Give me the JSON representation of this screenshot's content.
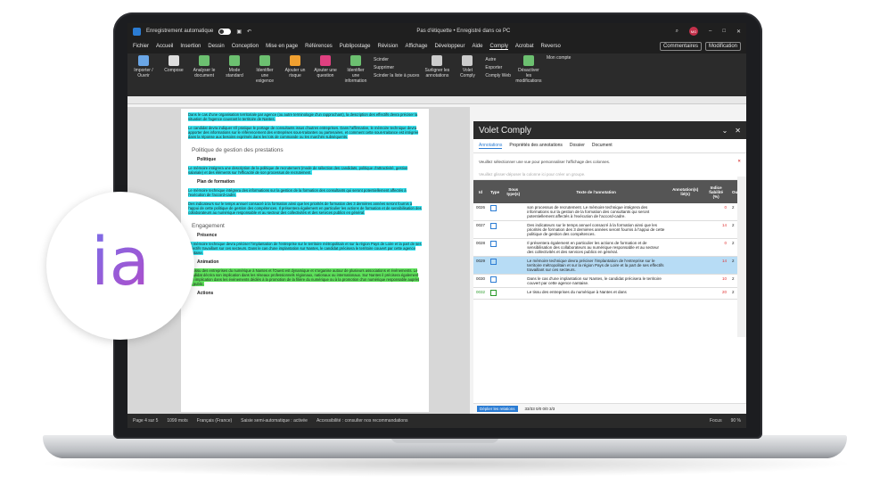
{
  "window": {
    "autosave_label": "Enregistrement automatique",
    "doc_title": "Pas d'étiquette • Enregistré dans ce PC",
    "avatar_initials": "MG"
  },
  "menu": {
    "items": [
      "Fichier",
      "Accueil",
      "Insertion",
      "Dessin",
      "Conception",
      "Mise en page",
      "Références",
      "Publipostage",
      "Révision",
      "Affichage",
      "Développeur",
      "Aide",
      "Comply",
      "Acrobat",
      "Reverso"
    ],
    "active": "Comply",
    "comments_label": "Commentaires",
    "modification_label": "Modification"
  },
  "ribbon": {
    "items": [
      "Importer / Ouvrir",
      "Compose",
      "Analyser le document",
      "Mode standard",
      "Identifier une exigence",
      "Ajouter un risque",
      "Ajouter une question",
      "Identifier une information"
    ],
    "list": [
      "Scinder",
      "Supprimer",
      "Scinder la liste à puces"
    ],
    "souligner": "Surligner les annotations",
    "volet": "Volet Comply",
    "autre": "Autre",
    "exporter": "Exporter",
    "comply_web": "Comply Web",
    "desactiver": "Désactiver les modifications",
    "mon_compte": "Mon compte",
    "group_compose": "Compose",
    "group_comply": "Comply"
  },
  "doc": {
    "p1": "Dans le cas d'une organisation territoriale par agence (ou autre terminologie d'un rapprochant), la description des effectifs devra préciser la situation de l'agence couvrant le territoire de Nantes.",
    "p2": "Le candidat devra indiquer s'il pratique le portage de consultants issus d'autres entreprises. Dans l'affirmative, le mémoire technique devra apporter des informations sur le référencement des entreprises sous-traitantes ou partenaires, et comment cette sous-traitance est intégrée dans la réponse aux besoins exprimés dans les lots de commande ou les marchés subséquents.",
    "h_gestion": "Politique de gestion des prestations",
    "h_politique": "Politique",
    "p3": "Le mémoire intégrera une description de la politique de recrutement (mode de sélection des candidats, politique d'attractivité, gestion salariale) et des éléments sur l'efficacité de son processus de recrutement.",
    "h_formation": "Plan de formation",
    "p4": "Le mémoire technique intégrera des informations sur la gestion de la formation des consultants qui seront potentiellement affectés à l'exécution de l'accord-cadre.",
    "p5": "Des indicateurs sur le temps annuel consacré à la formation ainsi que les priorités de formation des 3 dernières années seront fournis à l'appui de cette politique de gestion des compétences. Il présentera également en particulier les actions de formation et de sensibilisation des collaborateurs au numérique responsable et au secteur des collectivités et des services publics en général.",
    "h_engagement": "Engagement",
    "h_presence": "Présence",
    "p6": "Le mémoire technique devra préciser l'implantation de l'entreprise sur le territoire métropolitain et sur la région Pays de Loire et la part de ses effectifs travaillant sur ces secteurs. Dans le cas d'une implantation sur Nantes, le candidat précisera le territoire couvert par cette agence nantaise.",
    "h_animation": "Animation",
    "p7": "Le tissu des entreprises du numérique à Nantes et l'Ouest est dynamique et s'organise autour de plusieurs associations et événements. Le candidat décrira son implication dans les réseaux professionnels régionaux, nationaux ou internationaux. Sur Nantes il précisera également son implication dans les événements dédiés à la promotion de la filière du numérique ou à la promotion d'un numérique responsable auprès du public.",
    "h_actions": "Actions"
  },
  "status": {
    "page": "Page 4 sur 5",
    "words": "1099 mots",
    "lang": "Français (France)",
    "autosave": "Saisie semi-automatique : activée",
    "access": "Accessibilité : consulter nos recommandations",
    "focus": "Focus",
    "zoom": "90 %"
  },
  "panel": {
    "title": "Volet Comply",
    "tabs": [
      "Annotations",
      "Propriétés des annotations",
      "Dossier",
      "Document"
    ],
    "notice": "Veuillez sélectionner une vue pour personnaliser l'affichage des colonnes.",
    "group_hint": "Veuillez glisser-déposer la colonne ici pour créer un groupe.",
    "columns": [
      "Id",
      "Type",
      "Sous type(s)",
      "Texte de l'annotation",
      "Annotation(s) lié(s)",
      "Indice fiabilité (%)",
      "Ouvre"
    ],
    "rows": [
      {
        "id": "0026",
        "text": "son processus de recrutement. Le mémoire technique intégrera des informations sur la gestion de la formation des consultants qui seront potentiellement affectés à l'exécution de l'accord-cadre.",
        "score": "0",
        "ouvre": "2"
      },
      {
        "id": "0027",
        "text": "Des indicateurs sur le temps annuel consacré à la formation ainsi que les priorités de formation des 3 dernières années seront fournis à l'appui de cette politique de gestion des compétences.",
        "score": "14",
        "ouvre": "2"
      },
      {
        "id": "0028",
        "text": "Il présentera également en particulier les actions de formation et de sensibilisation des collaborateurs au numérique responsable et au secteur des collectivités et des services publics en général.",
        "score": "0",
        "ouvre": "2"
      },
      {
        "id": "0029",
        "text": "Le mémoire technique devra préciser l'implantation de l'entreprise sur le territoire métropolitain et sur la région Pays de Loire et la part de ses effectifs travaillant sur ces secteurs.",
        "score": "14",
        "ouvre": "2"
      },
      {
        "id": "0030",
        "text": "Dans le cas d'une implantation sur Nantes, le candidat précisera le territoire couvert par cette agence nantaise.",
        "score": "10",
        "ouvre": "2"
      },
      {
        "id": "0032",
        "text": "Le tissu des entreprises du numérique à Nantes et dans",
        "score": "20",
        "ouvre": "2"
      }
    ],
    "footer_btn": "Déplier les relations",
    "footer_counts": "33/33   0/0   0/0   3/3",
    "side_tabs": [
      "Colonnes",
      "Filtres",
      "Relations",
      "Filtres relations"
    ]
  },
  "logo": {
    "text": "ia"
  },
  "colors": {
    "cyan_highlight": "#36e3f0",
    "green_highlight": "#5fe35c",
    "accent": "#2b7cd3"
  }
}
